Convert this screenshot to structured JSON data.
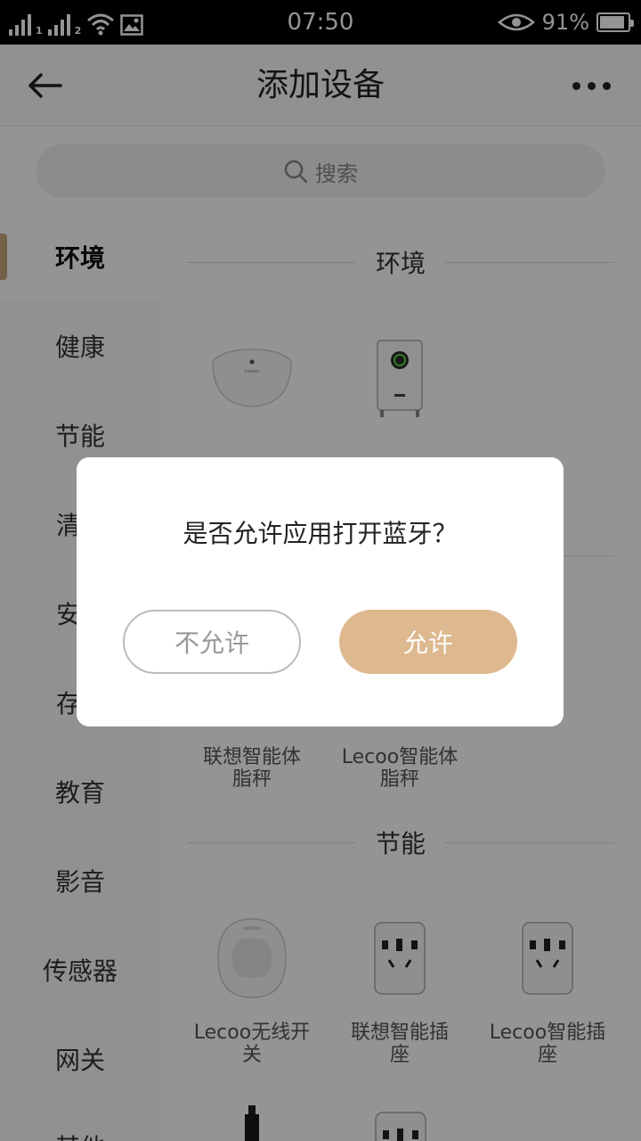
{
  "status_bar": {
    "time": "07:50",
    "battery_percent": "91%",
    "battery_level": 0.91,
    "sim1": "1",
    "sim2": "2",
    "icons": [
      "signal-icon",
      "signal-icon",
      "wifi-icon",
      "image-icon",
      "eye-icon",
      "battery-icon"
    ]
  },
  "app_bar": {
    "title": "添加设备"
  },
  "search": {
    "placeholder": "搜索"
  },
  "sidebar": {
    "items": [
      {
        "label": "环境"
      },
      {
        "label": "健康"
      },
      {
        "label": "节能"
      },
      {
        "label": "清"
      },
      {
        "label": "安"
      },
      {
        "label": "存"
      },
      {
        "label": "教育"
      },
      {
        "label": "影音"
      },
      {
        "label": "传感器"
      },
      {
        "label": "网关"
      },
      {
        "label": "其他"
      }
    ],
    "active_index": 0
  },
  "content": {
    "section_environment": "环境",
    "section_energy": "节能",
    "health_devices": [
      {
        "name_line1": "联想智能体",
        "name_line2": "脂秤"
      },
      {
        "name_line1": "Lecoo智能体",
        "name_line2": "脂秤"
      }
    ],
    "energy_devices": [
      {
        "name_line1": "Lecoo无线开",
        "name_line2": "关"
      },
      {
        "name_line1": "联想智能插",
        "name_line2": "座"
      },
      {
        "name_line1": "Lecoo智能插",
        "name_line2": "座"
      }
    ],
    "device_logo_text": "Lenovo"
  },
  "dialog": {
    "message": "是否允许应用打开蓝牙？",
    "deny_label": "不允许",
    "allow_label": "允许"
  },
  "colors": {
    "accent": "#deb88e",
    "indicator": "#c7a77d"
  }
}
